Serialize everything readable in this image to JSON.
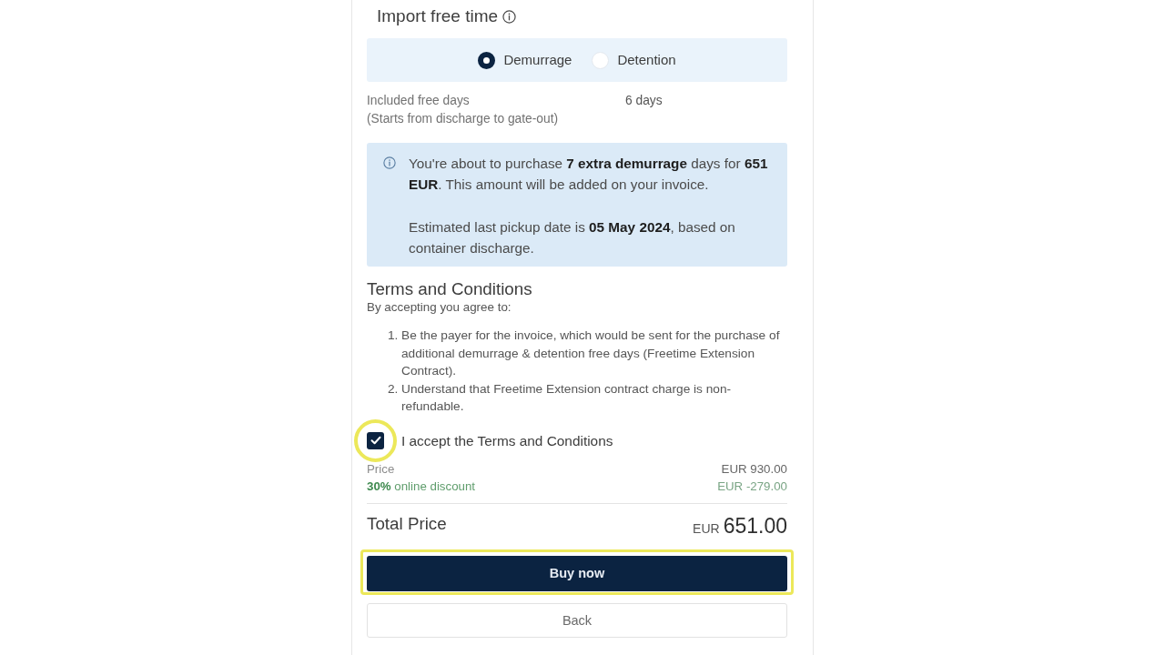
{
  "section": {
    "title": "Import free time"
  },
  "free_time_types": [
    {
      "label": "Demurrage",
      "selected": true
    },
    {
      "label": "Detention",
      "selected": false
    }
  ],
  "included_free_days": {
    "label": "Included free days",
    "note": "(Starts from discharge to gate-out)",
    "value": "6 days"
  },
  "notice": {
    "paragraphs": [
      "You're about to purchase **7 extra demurrage** days for **651 EUR**. This amount will be added on your invoice.",
      "Estimated last pickup date is **05 May 2024**, based on container discharge."
    ]
  },
  "terms": {
    "title": "Terms and Conditions",
    "intro": "By accepting you agree to:",
    "items": [
      {
        "number": "1.",
        "text": "Be the payer for the invoice, which would be sent for the purchase of additional demurrage & detention free days (Freetime Extension Contract)."
      },
      {
        "number": "2.",
        "text": "Understand that Freetime Extension contract charge is non-refundable."
      }
    ],
    "accept": {
      "label": "I accept the Terms and Conditions",
      "checked": true,
      "highlighted": true
    }
  },
  "pricing": {
    "rows": [
      {
        "kind": "base",
        "label": "Price",
        "amount": "EUR 930.00"
      },
      {
        "kind": "discount",
        "label": "**30%** online discount",
        "amount": "EUR -279.00"
      }
    ],
    "total": {
      "label": "Total Price",
      "currency": "EUR",
      "amount": "651.00"
    }
  },
  "buttons": [
    {
      "kind": "primary",
      "label": "Buy now",
      "highlighted": true
    },
    {
      "kind": "secondary",
      "label": "Back",
      "highlighted": false
    }
  ]
}
